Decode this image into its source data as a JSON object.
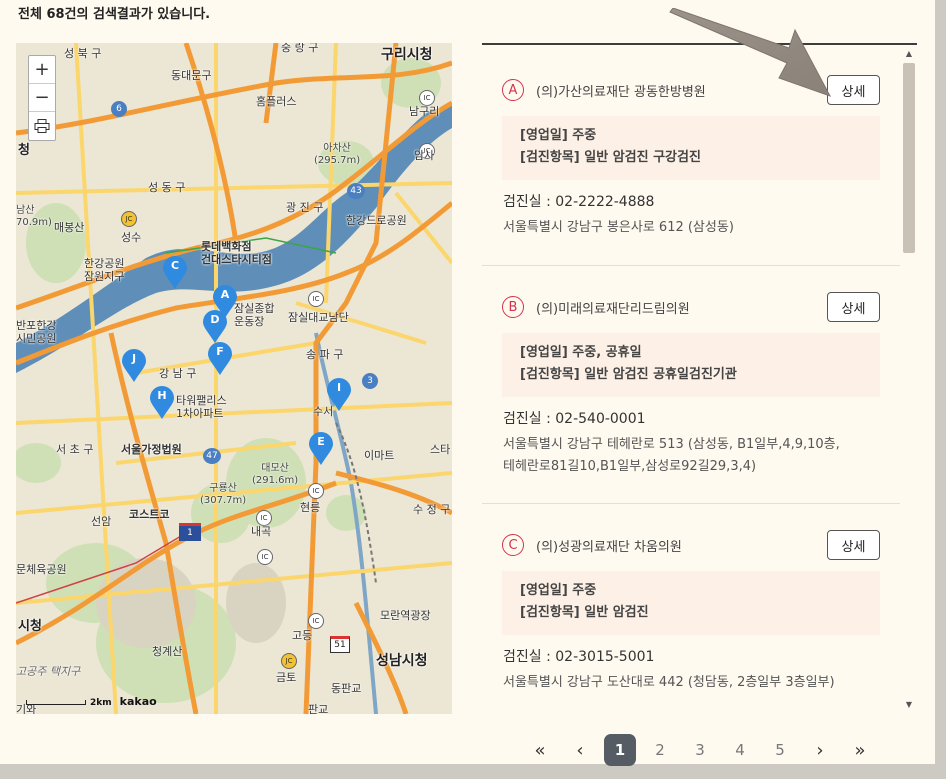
{
  "summary": {
    "text": "전체 68건의 검색결과가 있습니다."
  },
  "map": {
    "controls": {
      "zoom_in": "+",
      "zoom_out": "−",
      "print": "⎙"
    },
    "labels": {
      "seongbuk": "성 북 구",
      "dongdaemun": "동대문구",
      "junggu": "중 랑 구",
      "guri": "구리시청",
      "homeplus": "홈플러스",
      "namguri": "남구리",
      "achasan": "아차산\n(295.7m)",
      "amsa": "암사",
      "seongdong": "성 동 구",
      "gwangjin": "광 진 구",
      "ch_si": "청",
      "namsan": "남산\n70.9m)",
      "maebong": "매봉산",
      "seongsu": "성수",
      "lotte": "롯데백화점\n건대스타시티점",
      "hangang_dongro": "한강드로공원",
      "hangang_park": "한강공원\n잠원지구",
      "banpo": "반포한강\n시민공원",
      "jamsil_sports": "잠실종합\n운동장",
      "jamsil_bridge": "잠실대교남단",
      "songpa": "송 파 구",
      "gangnam": "강 남 구",
      "tower_palace": "타워팰리스\n1차아파트",
      "suseo": "수서",
      "seocho": "서 초 구",
      "court": "서울가정법원",
      "daemosan": "대모산\n(291.6m)",
      "emart": "이마트",
      "seuta": "스타",
      "guryongsan": "구룡산\n(307.7m)",
      "naegok": "내곡",
      "hyeonreung": "현릉",
      "sujeong": "수 정 구",
      "costco": "코스트코",
      "seonam": "선암",
      "sports_park": "문체육공원",
      "si_hall_left": "시청",
      "moran": "모란역광장",
      "cheonggyesan": "청계산",
      "godeung": "고등",
      "seongnam": "성남시청",
      "geumto": "금토",
      "dongpangyo": "동판교",
      "reservoir": "고공주 택지구",
      "pangyo": "판교",
      "giwa": "기와"
    },
    "markers": [
      {
        "id": "A"
      },
      {
        "id": "B"
      },
      {
        "id": "C"
      },
      {
        "id": "D"
      },
      {
        "id": "E"
      },
      {
        "id": "F"
      },
      {
        "id": "H"
      },
      {
        "id": "I"
      },
      {
        "id": "J"
      }
    ],
    "road_numbers": {
      "r6": "6",
      "r43": "43",
      "r3": "3",
      "r47": "47",
      "r1": "1",
      "r51": "51"
    },
    "ic_label": "IC",
    "jc_label": "JC",
    "scale": {
      "distance": "2km",
      "brand": "kakao"
    },
    "colors": {
      "water": "#5a8bb5",
      "park": "#c8dcb0",
      "highway": "#f29b36",
      "road": "#fbd66d",
      "marker": "#2f8ae0"
    }
  },
  "list": {
    "items": [
      {
        "letter": "A",
        "name": "(의)가산의료재단 광동한방병원",
        "detail": "상세",
        "hours": "[영업일] 주중",
        "checkup": "[검진항목] 일반 암검진 구강검진",
        "phone": "검진실 :  02-2222-4888",
        "address": "서울특별시 강남구 봉은사로 612 (삼성동)"
      },
      {
        "letter": "B",
        "name": "(의)미래의료재단리드림의원",
        "detail": "상세",
        "hours": "[영업일] 주중, 공휴일",
        "checkup": "[검진항목] 일반 암검진 공휴일검진기관",
        "phone": "검진실 :  02-540-0001",
        "address": "서울특별시 강남구 테헤란로 513 (삼성동, B1일부,4,9,10층,\n테헤란로81길10,B1일부,삼성로92길29,3,4)"
      },
      {
        "letter": "C",
        "name": "(의)성광의료재단 차움의원",
        "detail": "상세",
        "hours": "[영업일] 주중",
        "checkup": "[검진항목] 일반 암검진",
        "phone": "검진실 :  02-3015-5001",
        "address": "서울특별시 강남구 도산대로 442 (청담동, 2층일부 3층일부)"
      }
    ]
  },
  "pager": {
    "first": "«",
    "prev": "‹",
    "pages": [
      "1",
      "2",
      "3",
      "4",
      "5"
    ],
    "current": "1",
    "next": "›",
    "last": "»"
  }
}
